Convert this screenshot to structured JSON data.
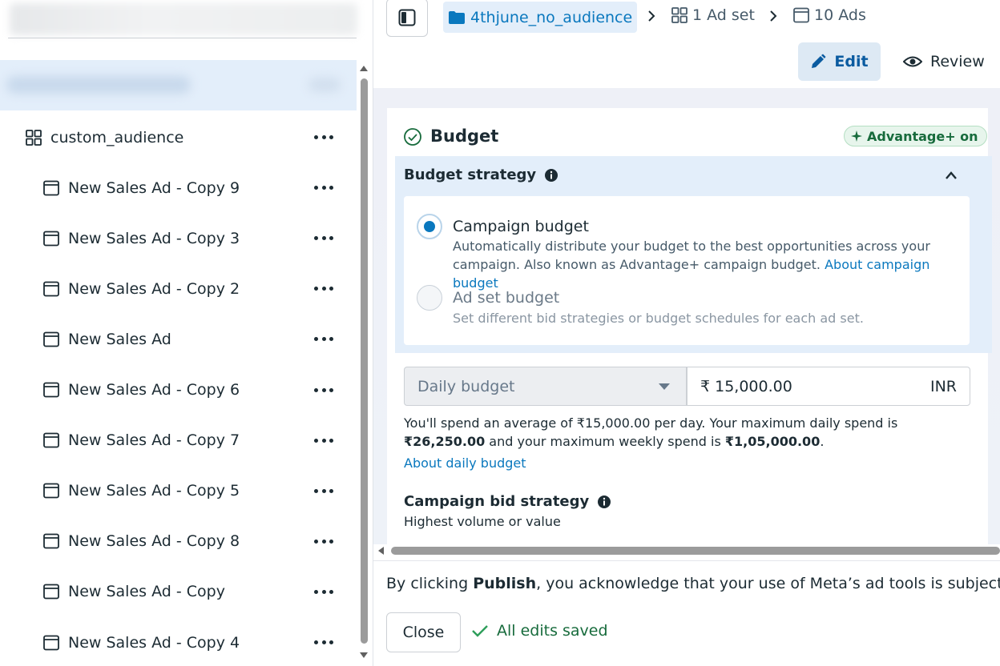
{
  "sidebar": {
    "items": [
      {
        "label": "custom_audience",
        "type": "adset"
      },
      {
        "label": "New Sales Ad - Copy 9",
        "type": "ad"
      },
      {
        "label": "New Sales Ad - Copy 3",
        "type": "ad"
      },
      {
        "label": "New Sales Ad - Copy 2",
        "type": "ad"
      },
      {
        "label": "New Sales Ad",
        "type": "ad"
      },
      {
        "label": "New Sales Ad - Copy 6",
        "type": "ad"
      },
      {
        "label": "New Sales Ad - Copy 7",
        "type": "ad"
      },
      {
        "label": "New Sales Ad - Copy 5",
        "type": "ad"
      },
      {
        "label": "New Sales Ad - Copy 8",
        "type": "ad"
      },
      {
        "label": "New Sales Ad - Copy",
        "type": "ad"
      },
      {
        "label": "New Sales Ad - Copy 4",
        "type": "ad"
      }
    ]
  },
  "header": {
    "campaign_name": "4thjune_no_audience",
    "adsets_label": "1 Ad set",
    "ads_label": "10 Ads",
    "edit_label": "Edit",
    "review_label": "Review"
  },
  "budget": {
    "title": "Budget",
    "advantage_badge": "Advantage+ on",
    "strategy_heading": "Budget strategy",
    "campaign_option": {
      "title": "Campaign budget",
      "desc": "Automatically distribute your budget to the best opportunities across your campaign. Also known as Advantage+ campaign budget.",
      "link": "About campaign budget",
      "selected": true
    },
    "adset_option": {
      "title": "Ad set budget",
      "desc": "Set different bid strategies or budget schedules for each ad set.",
      "selected": false
    },
    "type_select": "Daily budget",
    "amount": "₹ 15,000.00",
    "currency": "INR",
    "spend_note": {
      "p1": "You'll spend an average of ₹15,000.00 per day. Your maximum daily spend is ",
      "max_daily": "₹26,250.00",
      "p2": " and your maximum weekly spend is ",
      "max_weekly": "₹1,05,000.00",
      "p3": "."
    },
    "about_daily_link": "About daily budget",
    "bid_strategy_heading": "Campaign bid strategy",
    "bid_strategy_value": "Highest volume or value"
  },
  "footer": {
    "legal_prefix": "By clicking ",
    "legal_bold": "Publish",
    "legal_suffix": ", you acknowledge that your use of Meta’s ad tools is subject to our T",
    "close_label": "Close",
    "saved_label": "All edits saved"
  },
  "colors": {
    "accent": "#0a78be",
    "selected_bg": "#e3eefa",
    "success": "#176b3c"
  }
}
